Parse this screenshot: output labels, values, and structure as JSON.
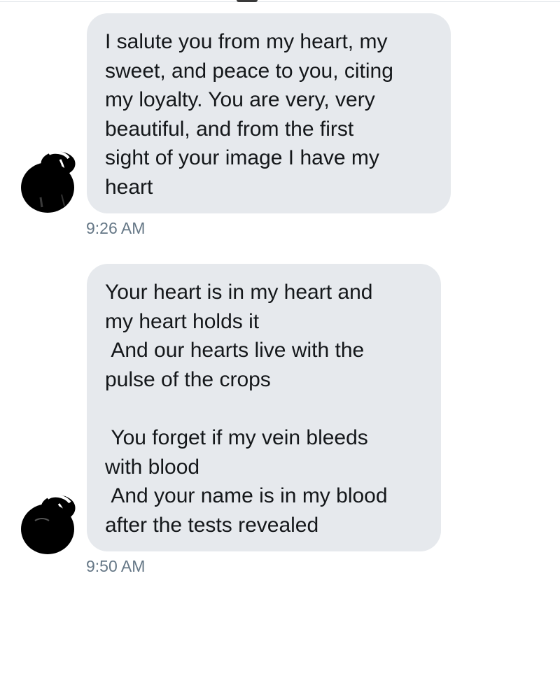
{
  "conversation": {
    "messages": [
      {
        "text": "I salute you from my heart, my\nsweet, and peace to you, citing\nmy loyalty. You are very, very\nbeautiful, and from the first\nsight of your image I have my\nheart",
        "timestamp": "9:26 AM",
        "avatar_icon": "redacted-avatar-icon"
      },
      {
        "text": "Your heart is in my heart and\nmy heart holds it\n And our hearts live with the\npulse of the crops\n\n You forget if my vein bleeds\nwith blood\n And your name is in my blood\nafter the tests revealed",
        "timestamp": "9:50 AM",
        "avatar_icon": "redacted-avatar-icon"
      }
    ]
  },
  "colors": {
    "bubble_background": "#e6e9ed",
    "message_text": "#14171a",
    "timestamp_text": "#657786",
    "redaction": "#000000"
  }
}
